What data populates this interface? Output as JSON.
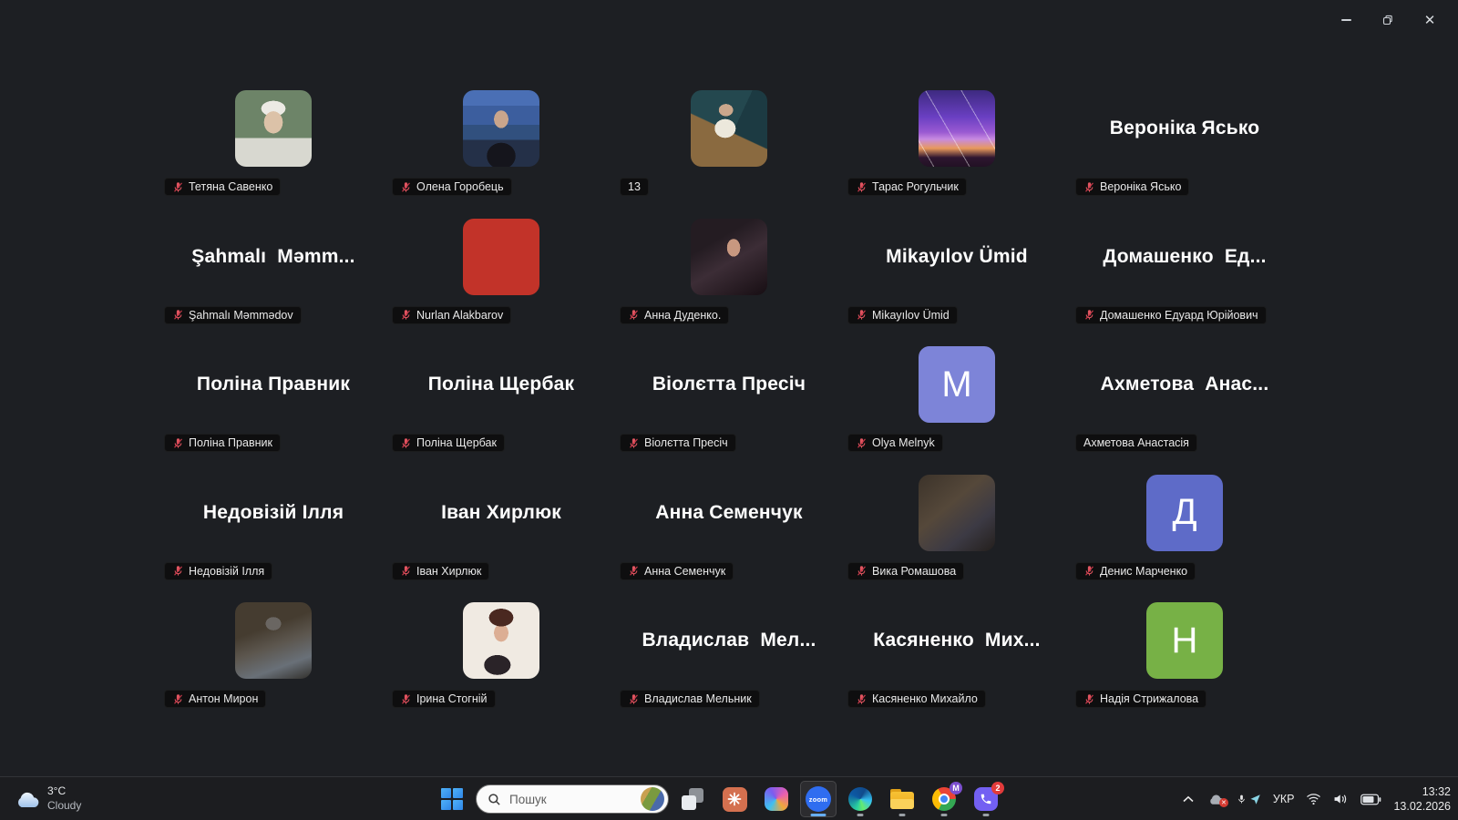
{
  "meeting": {
    "participants": [
      {
        "label": "Тетяна Савенко",
        "muted": true,
        "avatar": {
          "kind": "photo",
          "photo": "tetyana"
        }
      },
      {
        "label": "Олена Горобець",
        "muted": true,
        "avatar": {
          "kind": "photo",
          "photo": "olena"
        }
      },
      {
        "label": "13",
        "muted": false,
        "avatar": {
          "kind": "photo",
          "photo": "guy13"
        }
      },
      {
        "label": "Тарас Рогульчик",
        "muted": true,
        "avatar": {
          "kind": "photo",
          "photo": "taras"
        }
      },
      {
        "display": "Вероніка Ясько",
        "label": "Вероніка Ясько",
        "muted": true,
        "avatar": {
          "kind": "none"
        }
      },
      {
        "display": "Şahmalı  Məmm...",
        "label": "Şahmalı Məmmədov",
        "muted": true,
        "avatar": {
          "kind": "none"
        }
      },
      {
        "label": "Nurlan Alakbarov",
        "muted": true,
        "avatar": {
          "kind": "solid",
          "color": "#c23329"
        }
      },
      {
        "label": "Анна Дуденко.",
        "muted": true,
        "avatar": {
          "kind": "photo",
          "photo": "annad"
        }
      },
      {
        "display": "Mikayılov Ümid",
        "label": "Mikayılov Ümid",
        "muted": true,
        "avatar": {
          "kind": "none"
        }
      },
      {
        "display": "Домашенко  Ед...",
        "label": "Домашенко Едуард Юрійович",
        "muted": true,
        "avatar": {
          "kind": "none"
        }
      },
      {
        "display": "Поліна Правник",
        "label": "Поліна Правник",
        "muted": true,
        "avatar": {
          "kind": "none"
        }
      },
      {
        "display": "Поліна Щербак",
        "label": "Поліна Щербак",
        "muted": true,
        "avatar": {
          "kind": "none"
        }
      },
      {
        "display": "Віолєтта Пресіч",
        "label": "Віолєтта Пресіч",
        "muted": true,
        "avatar": {
          "kind": "none"
        }
      },
      {
        "label": "Olya Melnyk",
        "muted": true,
        "avatar": {
          "kind": "letter",
          "letter": "M",
          "color": "#7d84d8"
        }
      },
      {
        "display": "Ахметова  Анас...",
        "label": "Ахметова Анастасія",
        "muted": false,
        "avatar": {
          "kind": "none"
        }
      },
      {
        "display": "Недовізій Ілля",
        "label": "Недовізій Ілля",
        "muted": true,
        "avatar": {
          "kind": "none"
        }
      },
      {
        "display": "Іван Хирлюк",
        "label": "Іван Хирлюк",
        "muted": true,
        "avatar": {
          "kind": "none"
        }
      },
      {
        "display": "Анна Семенчук",
        "label": "Анна Семенчук",
        "muted": true,
        "avatar": {
          "kind": "none"
        }
      },
      {
        "label": "Вика Ромашова",
        "muted": true,
        "avatar": {
          "kind": "photo",
          "photo": "vika"
        }
      },
      {
        "label": "Денис Марченко",
        "muted": true,
        "avatar": {
          "kind": "letter",
          "letter": "Д",
          "color": "#5e6bc8"
        }
      },
      {
        "label": "Антон Мирон",
        "muted": true,
        "avatar": {
          "kind": "photo",
          "photo": "anton"
        }
      },
      {
        "label": "Ірина Стогній",
        "muted": true,
        "avatar": {
          "kind": "photo",
          "photo": "iryna"
        }
      },
      {
        "display": "Владислав  Мел...",
        "label": "Владислав Мельник",
        "muted": true,
        "avatar": {
          "kind": "none"
        }
      },
      {
        "display": "Касяненко  Мих...",
        "label": "Касяненко Михайло",
        "muted": true,
        "avatar": {
          "kind": "none"
        }
      },
      {
        "label": "Надія Стрижалова",
        "muted": true,
        "avatar": {
          "kind": "letter",
          "letter": "Н",
          "color": "#77b146"
        }
      }
    ],
    "muted_mic_color": "#e05560"
  },
  "taskbar": {
    "weather": {
      "temperature": "3°C",
      "condition": "Cloudy"
    },
    "search": {
      "placeholder": "Пошук"
    },
    "zoom_icon_text": "zoom",
    "apps": [
      {
        "id": "task-view",
        "running": false,
        "active": false,
        "badge": ""
      },
      {
        "id": "claude",
        "running": false,
        "active": false,
        "badge": ""
      },
      {
        "id": "copilot",
        "running": false,
        "active": false,
        "badge": ""
      },
      {
        "id": "zoom",
        "running": true,
        "active": true,
        "badge": ""
      },
      {
        "id": "edge",
        "running": true,
        "active": false,
        "badge": ""
      },
      {
        "id": "file-explorer",
        "running": true,
        "active": false,
        "badge": ""
      },
      {
        "id": "chrome",
        "running": true,
        "active": false,
        "badge": "M",
        "badge_color": "#7c4fd0"
      },
      {
        "id": "viber",
        "running": true,
        "active": false,
        "badge": "2",
        "badge_color": "#e23b3b"
      }
    ],
    "tray": {
      "language": "УКР",
      "time": "13:32",
      "date": "13.02.2026"
    }
  }
}
